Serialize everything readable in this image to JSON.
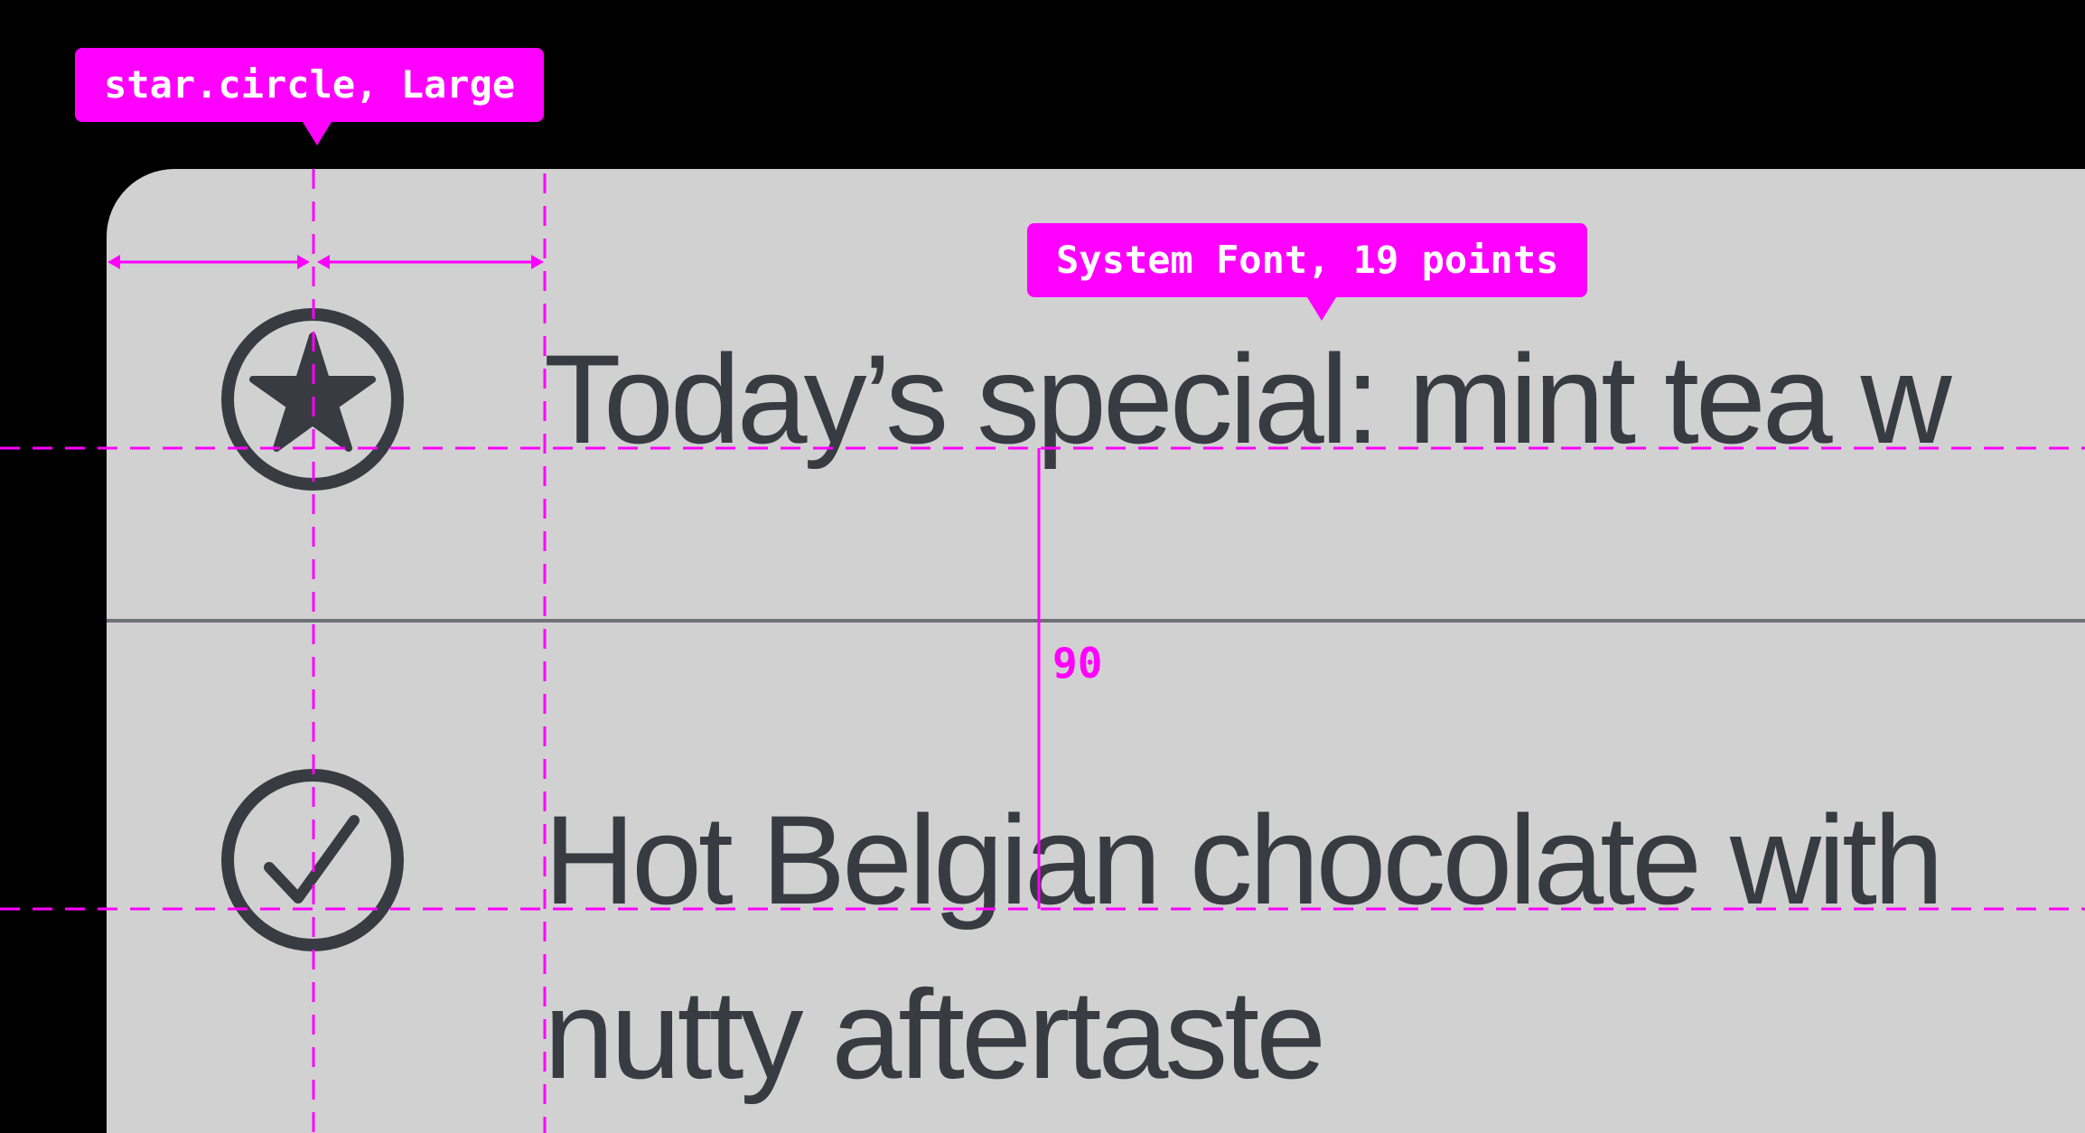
{
  "callouts": {
    "icon": "star.circle, Large",
    "font": "System Font, 19 points"
  },
  "rows": [
    {
      "icon": "star-circle-icon",
      "text": "Today’s special: mint tea w"
    },
    {
      "icon": "checkmark-circle-icon",
      "text": "Hot Belgian chocolate with",
      "continuation": "nutty aftertaste"
    }
  ],
  "measurement": {
    "row_spacing": "90"
  },
  "colors": {
    "background": "#000000",
    "panel": "#d1d1d1",
    "text": "#383c42",
    "divider": "#6d7177",
    "annotation": "#ff00ff"
  }
}
